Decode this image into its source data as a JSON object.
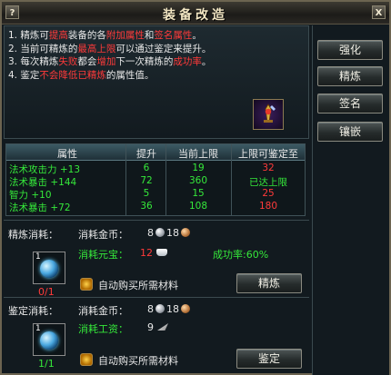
{
  "window": {
    "title": "装备改造",
    "help_label": "?",
    "close_label": "X"
  },
  "tips": [
    [
      {
        "t": "1. 精炼可",
        "c": "white"
      },
      {
        "t": "提高",
        "c": "red"
      },
      {
        "t": "装备的各",
        "c": "white"
      },
      {
        "t": "附加属性",
        "c": "red"
      },
      {
        "t": "和",
        "c": "white"
      },
      {
        "t": "签名属性",
        "c": "red"
      },
      {
        "t": "。",
        "c": "white"
      }
    ],
    [
      {
        "t": "2. 当前可精炼的",
        "c": "white"
      },
      {
        "t": "最高上限",
        "c": "red"
      },
      {
        "t": "可以通过鉴定来提升。",
        "c": "white"
      }
    ],
    [
      {
        "t": "3. 每次精炼",
        "c": "white"
      },
      {
        "t": "失败",
        "c": "red"
      },
      {
        "t": "都会",
        "c": "white"
      },
      {
        "t": "增加",
        "c": "red"
      },
      {
        "t": "下一次精炼的",
        "c": "white"
      },
      {
        "t": "成功率",
        "c": "red"
      },
      {
        "t": "。",
        "c": "white"
      }
    ],
    [
      {
        "t": "4. 鉴定",
        "c": "white"
      },
      {
        "t": "不会降低已精炼",
        "c": "red"
      },
      {
        "t": "的属性值。",
        "c": "white"
      }
    ]
  ],
  "side_buttons": [
    "强化",
    "精炼",
    "签名",
    "镶嵌"
  ],
  "table": {
    "headers": [
      "属性",
      "提升",
      "当前上限",
      "上限可鉴定至"
    ],
    "rows": [
      {
        "name": "法术攻击力 +13",
        "up": "6",
        "cap": "19",
        "max": "32",
        "max_color": "red"
      },
      {
        "name": "法术暴击 +144",
        "up": "72",
        "cap": "360",
        "max": "已达上限",
        "max_color": "green"
      },
      {
        "name": "智力 +10",
        "up": "5",
        "cap": "15",
        "max": "25",
        "max_color": "red"
      },
      {
        "name": "法术暴击 +72",
        "up": "36",
        "cap": "108",
        "max": "180",
        "max_color": "red"
      }
    ]
  },
  "refine": {
    "section_label": "精炼消耗：",
    "slot_num": "1",
    "slot_count": "0/1",
    "gold_label": "消耗金币：",
    "silver": "8",
    "copper": "18",
    "yuanbao_label": "消耗元宝：",
    "yuanbao": "12",
    "success_rate": "成功率:60%",
    "auto_buy": "自动购买所需材料",
    "button": "精炼"
  },
  "appraise": {
    "section_label": "鉴定消耗：",
    "slot_num": "1",
    "slot_count": "1/1",
    "gold_label": "消耗金币：",
    "silver": "8",
    "copper": "18",
    "wage_label": "消耗工资：",
    "wage": "9",
    "auto_buy": "自动购买所需材料",
    "button": "鉴定"
  }
}
